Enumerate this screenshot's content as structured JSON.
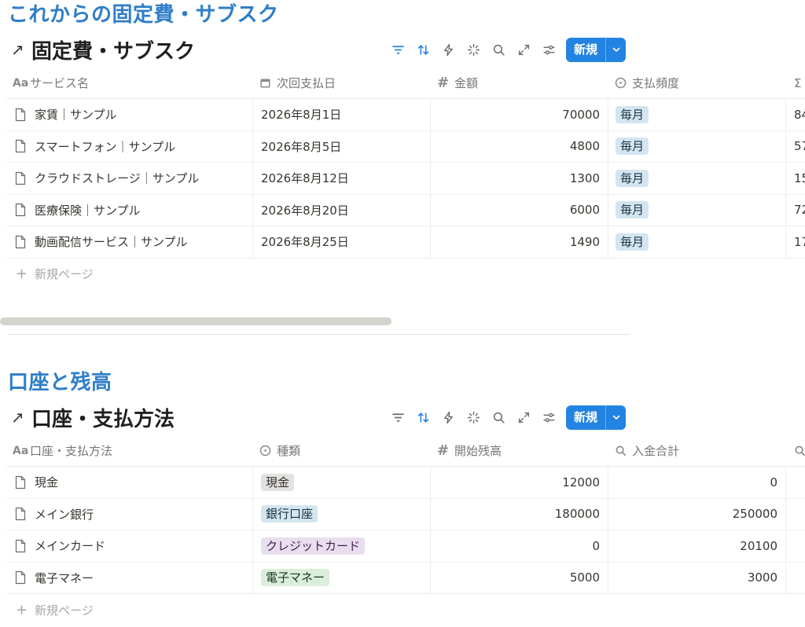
{
  "colors": {
    "accent": "#2f7ec7",
    "button": "#2383e2"
  },
  "section1": {
    "heading": "これからの固定費・サブスク",
    "db_title": "固定費・サブスク",
    "new_label": "新規",
    "columns": [
      "サービス名",
      "次回支払日",
      "金額",
      "支払頻度",
      "Σ"
    ],
    "column_icons": [
      "Aa",
      "calendar-icon",
      "#",
      "select-icon",
      "sigma-icon"
    ],
    "rows": [
      {
        "name": "家賃｜サンプル",
        "date": "2026年8月1日",
        "amount": "70000",
        "freq": "毎月",
        "sum": "84"
      },
      {
        "name": "スマートフォン｜サンプル",
        "date": "2026年8月5日",
        "amount": "4800",
        "freq": "毎月",
        "sum": "57"
      },
      {
        "name": "クラウドストレージ｜サンプル",
        "date": "2026年8月12日",
        "amount": "1300",
        "freq": "毎月",
        "sum": "15"
      },
      {
        "name": "医療保険｜サンプル",
        "date": "2026年8月20日",
        "amount": "6000",
        "freq": "毎月",
        "sum": "72"
      },
      {
        "name": "動画配信サービス｜サンプル",
        "date": "2026年8月25日",
        "amount": "1490",
        "freq": "毎月",
        "sum": "17"
      }
    ],
    "add_label": "新規ページ"
  },
  "section2": {
    "heading": "口座と残高",
    "db_title": "口座・支払方法",
    "new_label": "新規",
    "columns": [
      "口座・支払方法",
      "種類",
      "開始残高",
      "入金合計",
      ""
    ],
    "rows": [
      {
        "name": "現金",
        "type": "現金",
        "type_color": "gray",
        "start": "12000",
        "deposit": "0"
      },
      {
        "name": "メイン銀行",
        "type": "銀行口座",
        "type_color": "blue",
        "start": "180000",
        "deposit": "250000"
      },
      {
        "name": "メインカード",
        "type": "クレジットカード",
        "type_color": "purple",
        "start": "0",
        "deposit": "20100"
      },
      {
        "name": "電子マネー",
        "type": "電子マネー",
        "type_color": "green",
        "start": "5000",
        "deposit": "3000"
      }
    ],
    "add_label": "新規ページ"
  }
}
